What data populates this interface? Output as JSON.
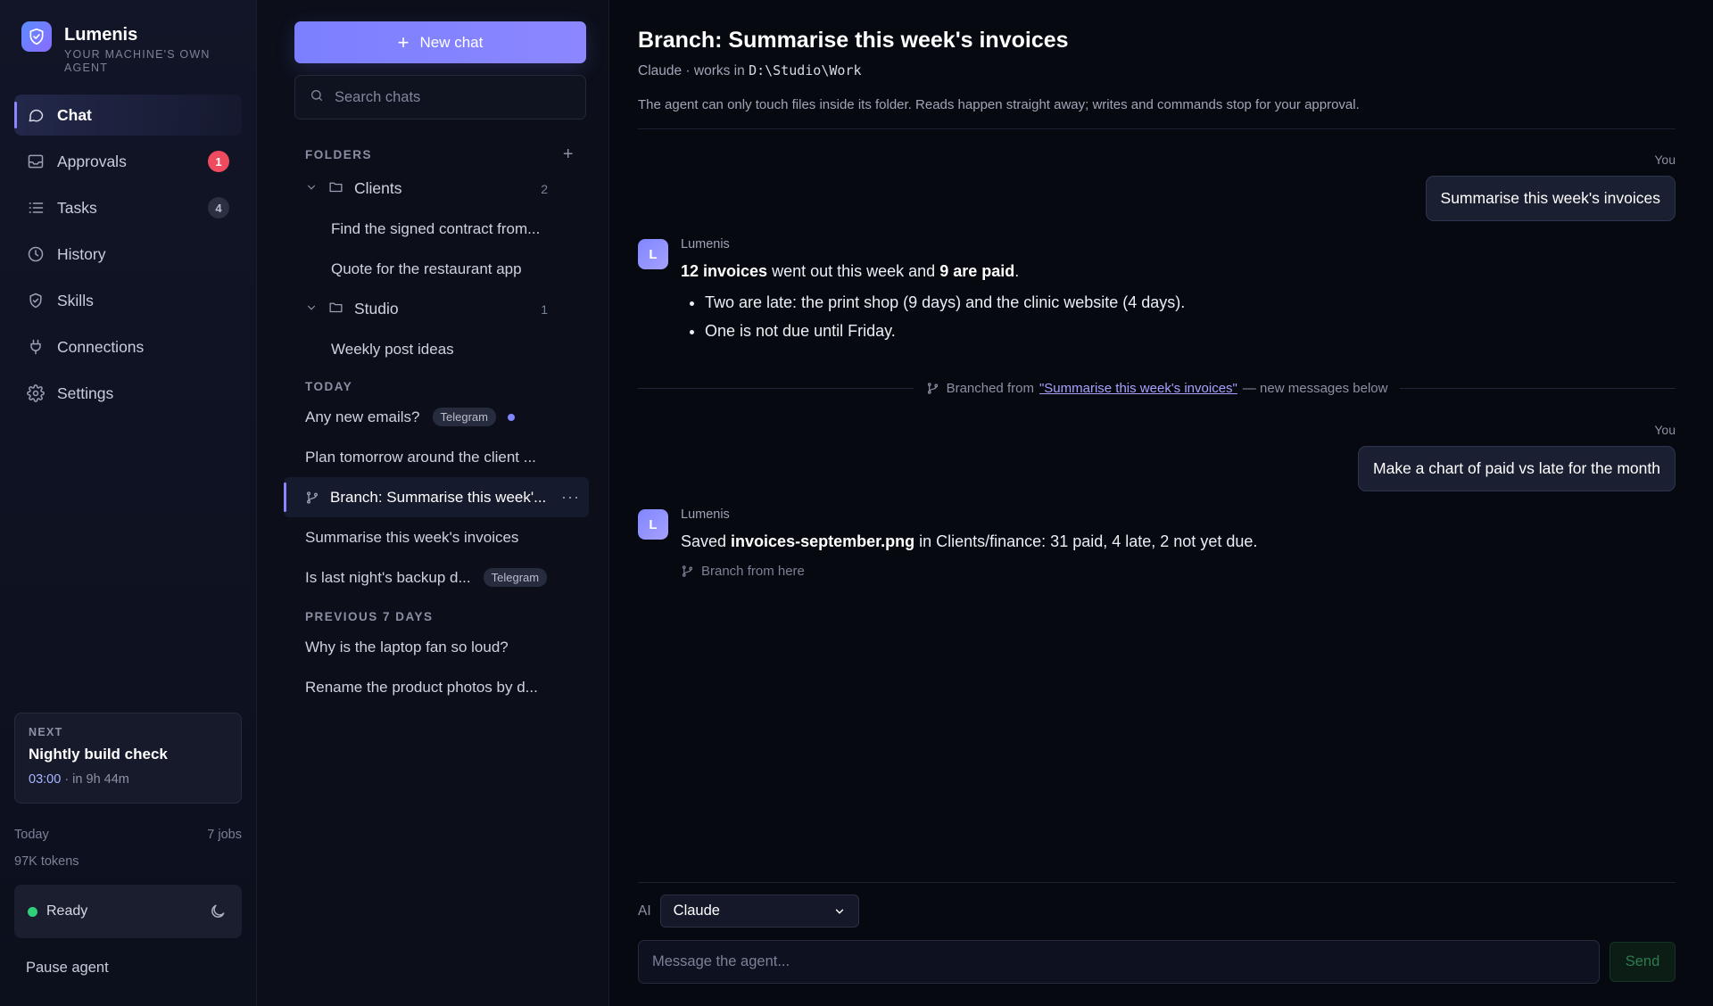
{
  "brand": {
    "name": "Lumenis",
    "tagline": "YOUR MACHINE'S OWN AGENT"
  },
  "nav": {
    "items": [
      {
        "label": "Chat",
        "icon": "chat-bubble-icon",
        "active": true
      },
      {
        "label": "Approvals",
        "icon": "inbox-icon",
        "badge": "1",
        "badge_color": "#ef4b5e"
      },
      {
        "label": "Tasks",
        "icon": "list-icon",
        "badge": "4"
      },
      {
        "label": "History",
        "icon": "clock-icon"
      },
      {
        "label": "Skills",
        "icon": "shield-icon"
      },
      {
        "label": "Connections",
        "icon": "plug-icon"
      },
      {
        "label": "Settings",
        "icon": "gear-icon"
      }
    ],
    "next": {
      "label": "NEXT",
      "title": "Nightly build check",
      "time": "03:00",
      "eta": "· in 9h 44m"
    },
    "usage": {
      "period": "Today",
      "jobs": "7 jobs",
      "tokens": "97K tokens"
    },
    "status": {
      "text": "Ready",
      "color": "#2fd07a"
    },
    "pause_label": "Pause agent"
  },
  "list": {
    "new_chat_label": "New chat",
    "search_placeholder": "Search chats",
    "folders_heading": "FOLDERS",
    "folders": [
      {
        "name": "Clients",
        "count": "2",
        "chats": [
          "Find the signed contract from...",
          "Quote for the restaurant app"
        ]
      },
      {
        "name": "Studio",
        "count": "1",
        "chats": [
          "Weekly post ideas"
        ]
      }
    ],
    "today_heading": "TODAY",
    "today": [
      {
        "title": "Any new emails?",
        "tag": "Telegram",
        "unread": true
      },
      {
        "title": "Plan tomorrow around the client ..."
      },
      {
        "title": "Branch: Summarise this week'...",
        "branch": true,
        "active": true
      },
      {
        "title": "Summarise this week's invoices"
      },
      {
        "title": "Is last night's backup d...",
        "tag": "Telegram"
      }
    ],
    "previous_heading": "PREVIOUS 7 DAYS",
    "previous": [
      "Why is the laptop fan so loud?",
      "Rename the product photos by d..."
    ]
  },
  "main": {
    "title": "Branch: Summarise this week's invoices",
    "subtitle_prefix": "Claude · works in",
    "workdir": "D:\\Studio\\Work",
    "note": "The agent can only touch files inside its folder. Reads happen straight away; writes and commands stop for your approval.",
    "you_label": "You",
    "msg1": "Summarise this week's invoices",
    "agent_name": "Lumenis",
    "agent_initial": "L",
    "reply1": {
      "strong1": "12 invoices",
      "text1": " went out this week and ",
      "strong2": "9 are paid",
      "text2": ".",
      "bullets": [
        "Two are late: the print shop (9 days) and the clinic website (4 days).",
        "One is not due until Friday."
      ]
    },
    "branch_divider": {
      "prefix": "Branched from",
      "link": "\"Summarise this week's invoices\"",
      "suffix": "— new messages below"
    },
    "msg2": "Make a chart of paid vs late for the month",
    "reply2": {
      "prefix": "Saved ",
      "file": "invoices-september.png",
      "suffix": " in Clients/finance: 31 paid, 4 late, 2 not yet due."
    },
    "branch_here": "Branch from here",
    "model_label": "AI",
    "model_value": "Claude",
    "message_placeholder": "Message the agent...",
    "send_label": "Send"
  }
}
